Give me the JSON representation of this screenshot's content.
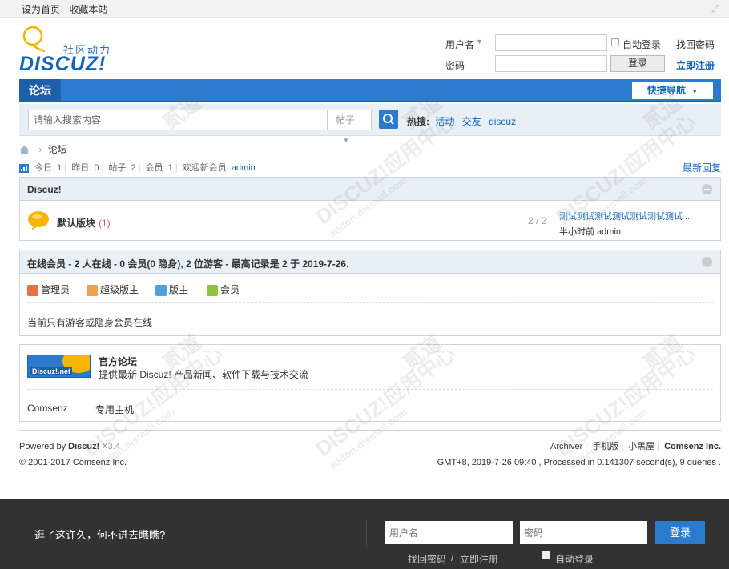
{
  "topbar": {
    "set_home": "设为首页",
    "bookmark": "收藏本站"
  },
  "logo": {
    "slogan": "社区动力",
    "word": "DISCUZ!"
  },
  "login": {
    "username_label": "用户名",
    "password_label": "密码",
    "auto_login_label": "自动登录",
    "find_password": "找回密码",
    "login_button": "登录",
    "register": "立即注册",
    "username_value": "",
    "password_value": ""
  },
  "nav": {
    "active_tab": "论坛",
    "quick_nav": "快捷导航"
  },
  "search": {
    "placeholder": "请输入搜索内容",
    "type_select": "帖子",
    "hot_label": "热搜:",
    "hot_items": [
      "活动",
      "交友",
      "discuz"
    ]
  },
  "breadcrumb": {
    "current": "论坛"
  },
  "stats": {
    "today": "今日: 1",
    "yesterday": "昨日: 0",
    "posts": "帖子: 2",
    "members": "会员: 1",
    "welcome": "欢迎新会员:",
    "new_member": "admin",
    "latest_reply": "最新回复"
  },
  "category": {
    "title": "Discuz!",
    "forums": [
      {
        "name": "默认版块",
        "count": "(1)",
        "ratio": "2 / 2",
        "last_post_title": "测试测试测试测试测试测试测试 ...",
        "last_post_meta": "半小时前 admin"
      }
    ]
  },
  "online": {
    "title": "在线会员 - 2 人在线 - 0 会员(0 隐身), 2 位游客 - 最高记录是 2 于 2019-7-26.",
    "legend": [
      "管理员",
      "超级版主",
      "版主",
      "会员"
    ],
    "legend_colors": [
      "#e8713d",
      "#f0a24a",
      "#4aa3df",
      "#8cc43c"
    ],
    "note": "当前只有游客或隐身会员在线"
  },
  "links": {
    "banner_text": "Discuz!.net",
    "title": "官方论坛",
    "desc": "提供最新 Discuz! 产品新闻、软件下载与技术交流",
    "text_links": [
      "Comsenz",
      "专用主机"
    ]
  },
  "footer": {
    "powered_by": "Powered by",
    "product": "Discuz!",
    "version": "X3.4",
    "copyright": "© 2001-2017 Comsenz Inc.",
    "links": [
      "Archiver",
      "手机版",
      "小黑屋"
    ],
    "company": "Comsenz Inc.",
    "runtime": "GMT+8, 2019-7-26 09:40 , Processed in 0.141307 second(s), 9 queries ."
  },
  "bottom_bar": {
    "message": "逛了这许久，何不进去瞧瞧?",
    "username_placeholder": "用户名",
    "password_placeholder": "密码",
    "login_button": "登录",
    "find_password": "找回密码",
    "separator": "/",
    "register": "立即注册",
    "auto_login": "自动登录"
  },
  "watermark": {
    "main": "DISCUZ!应用中心",
    "sub": "addon.dismall.com",
    "mark": "贰道"
  },
  "colors": {
    "brand_blue": "#2b7acd",
    "nav_dark_blue": "#1f5ea8",
    "link_blue": "#1666b8",
    "bottom_bar": "#323232"
  }
}
